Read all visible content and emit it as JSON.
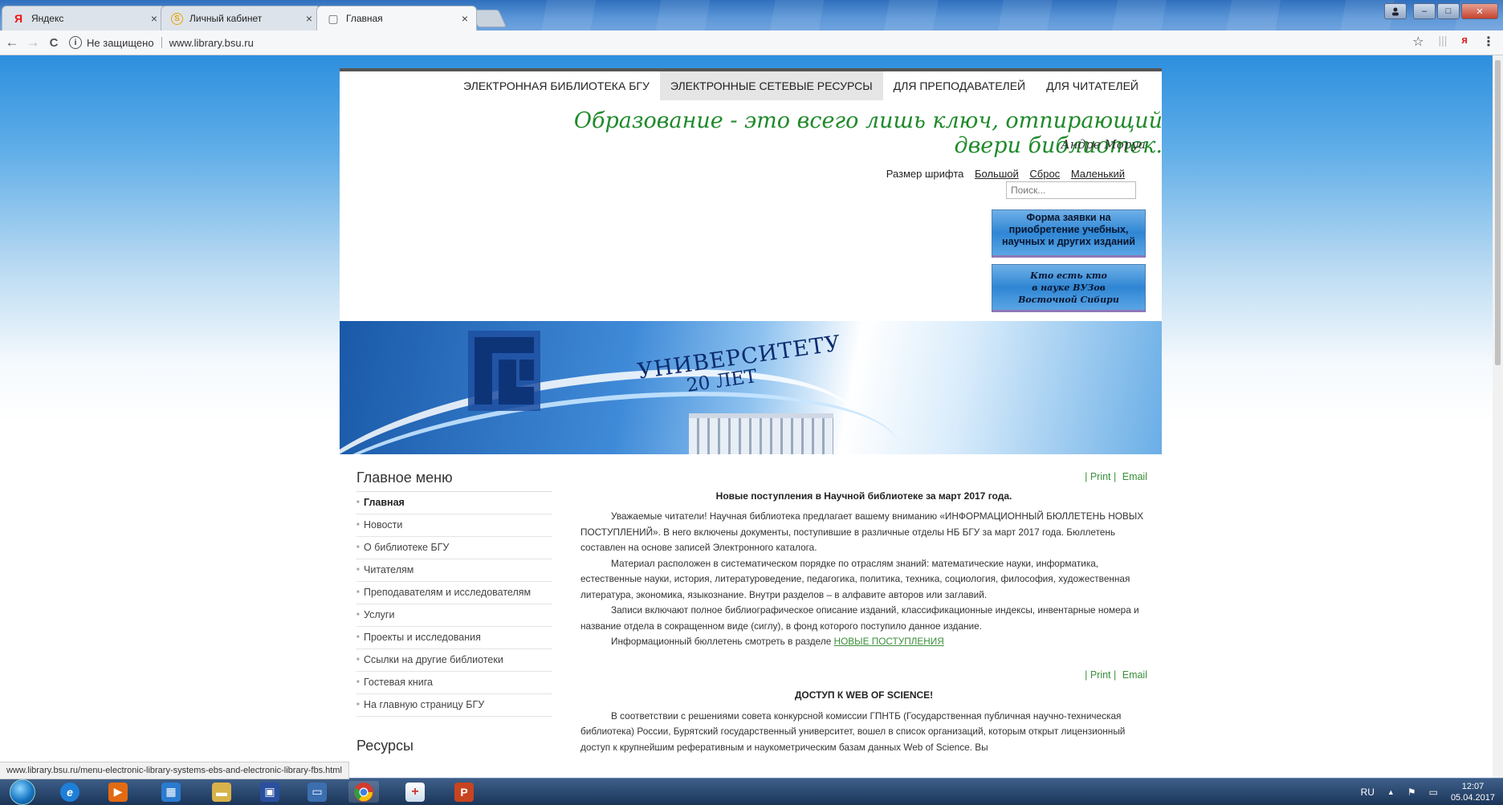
{
  "browser": {
    "tabs": [
      {
        "favicon": "Я",
        "favicon_color": "#e11",
        "title": "Яндекс",
        "close": "×"
      },
      {
        "favicon": "S",
        "favicon_color": "#e8a400",
        "title": "Личный кабинет",
        "close": "×"
      },
      {
        "favicon": "▢",
        "favicon_color": "#666",
        "title": "Главная",
        "close": "×"
      }
    ],
    "nav": {
      "back": "←",
      "forward": "→",
      "reload": "C"
    },
    "security_label": "Не защищено",
    "url": "www.library.bsu.ru",
    "bookmark_icon": "☆",
    "yandex_icon": "я",
    "menu_icon": "⋮",
    "status_url": "www.library.bsu.ru/menu-electronic-library-systems-ebs-and-electronic-library-fbs.html"
  },
  "site": {
    "topnav": [
      {
        "label": "ЭЛЕКТРОННАЯ БИБЛИОТЕКА БГУ",
        "selected": false
      },
      {
        "label": "ЭЛЕКТРОННЫЕ СЕТЕВЫЕ РЕСУРСЫ",
        "selected": true
      },
      {
        "label": "ДЛЯ ПРЕПОДАВАТЕЛЕЙ",
        "selected": false
      },
      {
        "label": "ДЛЯ ЧИТАТЕЛЕЙ",
        "selected": false
      }
    ],
    "motto": "Образование - это всего лишь ключ, отпирающий двери библиотек.",
    "motto_author": "Андре Моруа",
    "fontsize": {
      "label": "Размер шрифта",
      "large": "Большой",
      "reset": "Сброс",
      "small": "Маленький"
    },
    "search_placeholder": "Поиск...",
    "order_button": "Форма заявки на приобретение учебных, научных и других изданий",
    "who_button_lines": [
      "Кто есть кто",
      "в науке ВУЗов",
      "Восточной Сибири"
    ],
    "banner": {
      "logo_text": "БГУ",
      "line1": "УНИВЕРСИТЕТУ",
      "line2": "20 ЛЕТ"
    },
    "main_menu": {
      "title": "Главное меню",
      "items": [
        "Главная",
        "Новости",
        "О библиотеке БГУ",
        "Читателям",
        "Преподавателям и исследователям",
        "Услуги",
        "Проекты и исследования",
        "Ссылки на другие библиотеки",
        "Гостевая книга",
        "На главную страницу БГУ"
      ]
    },
    "resources_title": "Ресурсы",
    "print_label": "| Print |",
    "email_label": "Email",
    "article1": {
      "title": "Новые поступления в Научной библиотеке за март 2017 года.",
      "p1": "Уважаемые читатели! Научная библиотека предлагает вашему вниманию «ИНФОРМАЦИОННЫЙ БЮЛЛЕТЕНЬ НОВЫХ ПОСТУПЛЕНИЙ». В него включены документы, поступившие в различные отделы НБ БГУ за март 2017 года. Бюллетень составлен на основе записей Электронного каталога.",
      "p2": "Материал расположен в систематическом порядке по отраслям знаний: математические науки, информатика, естественные науки, история, литературоведение, педагогика, политика, техника, социология, философия, художественная литература, экономика, языкознание. Внутри разделов – в алфавите авторов или заглавий.",
      "p3": "Записи включают полное библиографическое описание изданий, классификационные индексы, инвентарные номера и название отдела в сокращенном виде (сиглу), в фонд которого поступило данное издание.",
      "p4_text": "Информационный бюллетень смотреть в разделе",
      "p4_link": "НОВЫЕ ПОСТУПЛЕНИЯ"
    },
    "article2": {
      "title": "ДОСТУП К WEB OF SCIENCE!",
      "p1": "В соответствии с решениями совета конкурсной комиссии ГПНТБ (Государственная публичная научно-техническая библиотека) России, Бурятский государственный университет, вошел в список организаций, которым открыт лицензионный доступ к крупнейшим реферативным и наукометрическим базам данных Web of Science. Вы"
    }
  },
  "taskbar": {
    "icons": [
      {
        "name": "ie-icon",
        "glyph": "e",
        "color": "#1e7fd8"
      },
      {
        "name": "media-player-icon",
        "glyph": "▶",
        "color": "#e36b12"
      },
      {
        "name": "apps-grid-icon",
        "glyph": "▦",
        "color": "#2a7bd0"
      },
      {
        "name": "file-explorer-icon",
        "glyph": "▬",
        "color": "#d8b24a"
      },
      {
        "name": "save-disk-icon",
        "glyph": "▣",
        "color": "#2a4fa0"
      },
      {
        "name": "remote-desktop-icon",
        "glyph": "▭",
        "color": "#3b6fb0"
      },
      {
        "name": "chrome-icon",
        "glyph": "◉",
        "color": "#d23b2f"
      },
      {
        "name": "consultant-plus-icon",
        "glyph": "+",
        "color": "#c33"
      },
      {
        "name": "powerpoint-icon",
        "glyph": "P",
        "color": "#c8441f"
      }
    ],
    "lang": "RU",
    "tray_arrow": "▲",
    "time": "12:07",
    "date": "05.04.2017"
  }
}
